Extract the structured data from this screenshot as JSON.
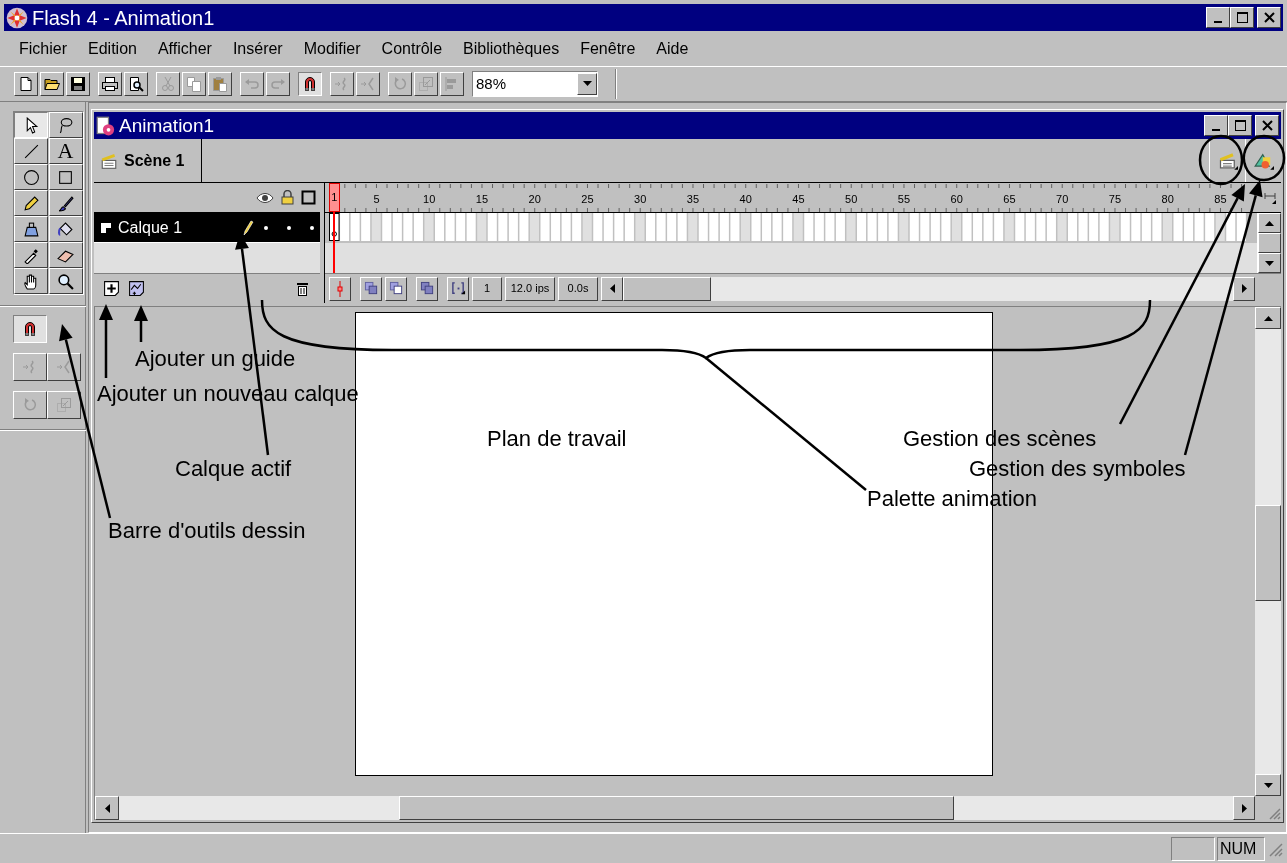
{
  "window": {
    "title": "Flash 4 - Animation1"
  },
  "menu": [
    {
      "label": "Fichier"
    },
    {
      "label": "Edition"
    },
    {
      "label": "Afficher"
    },
    {
      "label": "Insérer"
    },
    {
      "label": "Modifier"
    },
    {
      "label": "Contrôle"
    },
    {
      "label": "Bibliothèques"
    },
    {
      "label": "Fenêtre"
    },
    {
      "label": "Aide"
    }
  ],
  "toolbar": [
    {
      "disabled": false,
      "pressed": false
    },
    {
      "disabled": false,
      "pressed": false
    },
    {
      "disabled": false,
      "pressed": false
    },
    {
      "disabled": false,
      "pressed": false
    },
    {
      "disabled": false,
      "pressed": false
    },
    {
      "disabled": true,
      "pressed": false
    },
    {
      "disabled": true,
      "pressed": false
    },
    {
      "disabled": true,
      "pressed": false
    },
    {
      "disabled": true,
      "pressed": false
    },
    {
      "disabled": true,
      "pressed": false
    },
    {
      "disabled": false,
      "pressed": true
    },
    {
      "disabled": true,
      "pressed": false
    },
    {
      "disabled": true,
      "pressed": false
    },
    {
      "disabled": true,
      "pressed": false
    },
    {
      "disabled": true,
      "pressed": false
    },
    {
      "disabled": true,
      "pressed": false
    }
  ],
  "zoom": {
    "value": "88%"
  },
  "toolbox": {
    "tools": [
      {
        "selected": true
      },
      {
        "selected": false
      },
      {
        "selected": false
      },
      {
        "glyph": "A",
        "selected": false
      },
      {
        "selected": false
      },
      {
        "selected": false
      },
      {
        "selected": false
      },
      {
        "selected": false
      },
      {
        "selected": false
      },
      {
        "selected": false
      },
      {
        "selected": false
      },
      {
        "selected": false
      },
      {
        "selected": false
      },
      {
        "selected": false
      }
    ],
    "options": [
      {
        "disabled": false,
        "pressed": true
      },
      {
        "disabled": true,
        "pressed": false
      },
      {
        "disabled": true,
        "pressed": false
      },
      {
        "disabled": true,
        "pressed": false
      },
      {
        "disabled": true,
        "pressed": false
      }
    ]
  },
  "document": {
    "title": "Animation1",
    "scene": "Scène 1",
    "timeline": {
      "ruler": [
        "1",
        "5",
        "10",
        "15",
        "20",
        "25",
        "30",
        "35",
        "40",
        "45",
        "50",
        "55",
        "60",
        "65",
        "70",
        "75",
        "80",
        "85"
      ],
      "layers": [
        {
          "name": "Calque 1",
          "selected": true
        }
      ],
      "current_frame": "1",
      "frame_rate": "12.0 ips",
      "elapsed": "0.0s"
    }
  },
  "annotations": [
    {
      "text": "Ajouter un guide"
    },
    {
      "text": "Ajouter un nouveau calque"
    },
    {
      "text": "Plan de travail"
    },
    {
      "text": "Gestion des scènes"
    },
    {
      "text": "Calque actif"
    },
    {
      "text": "Gestion des symboles"
    },
    {
      "text": "Palette animation"
    },
    {
      "text": "Barre d'outils dessin"
    }
  ],
  "status_bar": {
    "indicator": "NUM"
  }
}
